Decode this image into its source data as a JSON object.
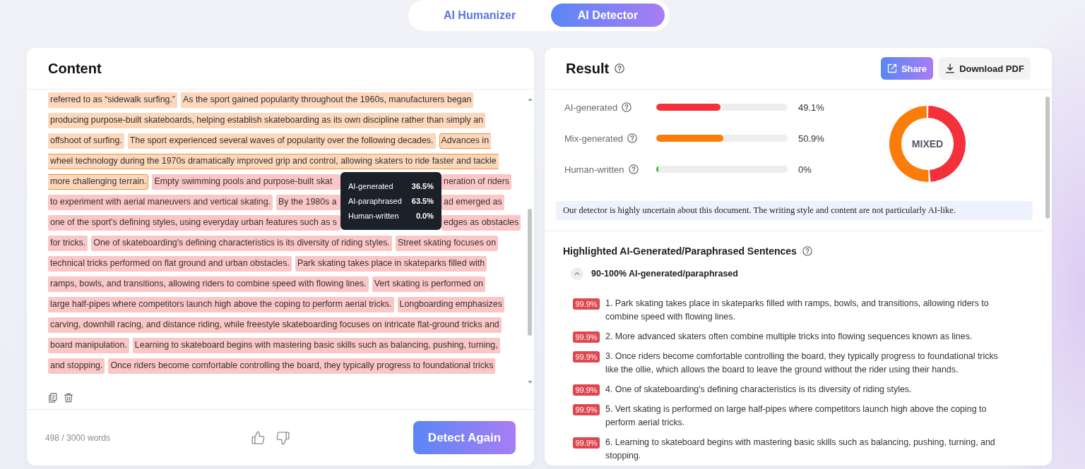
{
  "mode_tabs": [
    {
      "label": "AI Humanizer",
      "selected": false
    },
    {
      "label": "AI Detector",
      "selected": true
    }
  ],
  "content": {
    "title": "Content",
    "lines": [
      {
        "segments": [
          {
            "text": "referred to as “sidewalk surfing.”",
            "kind": "paraphrased",
            "selected": false
          },
          {
            "text": "As the sport gained popularity throughout the 1960s, manufacturers began",
            "kind": "paraphrased",
            "selected": false
          }
        ]
      },
      {
        "segments": [
          {
            "text": "producing purpose-built skateboards, helping establish skateboarding as its own discipline rather than simply an",
            "kind": "paraphrased",
            "selected": false
          }
        ]
      },
      {
        "segments": [
          {
            "text": "offshoot of surfing.",
            "kind": "paraphrased",
            "selected": false
          },
          {
            "text": "The sport experienced several waves of popularity over the following decades.",
            "kind": "paraphrased",
            "selected": false
          },
          {
            "text": "Advances in",
            "kind": "paraphrased",
            "selected": true
          }
        ]
      },
      {
        "segments": [
          {
            "text": "wheel technology during the 1970s dramatically improved grip and control, allowing skaters to ride faster and tackle",
            "kind": "paraphrased",
            "selected": true
          }
        ]
      },
      {
        "segments": [
          {
            "text": "more challenging terrain.",
            "kind": "paraphrased",
            "selected": true
          },
          {
            "text": "Empty swimming pools and purpose-built skat",
            "kind": "generated",
            "selected": false
          }
        ],
        "after_tooltip": [
          {
            "text": "neration of riders",
            "kind": "generated",
            "selected": false
          }
        ]
      },
      {
        "segments": [
          {
            "text": "to experiment with aerial maneuvers and vertical skating.",
            "kind": "generated",
            "selected": false
          },
          {
            "text": "By the 1980s a",
            "kind": "generated",
            "selected": false
          }
        ],
        "after_tooltip": [
          {
            "text": "ad emerged as",
            "kind": "generated",
            "selected": false
          }
        ]
      },
      {
        "segments": [
          {
            "text": "one of the sport's defining styles, using everyday urban features such as s",
            "kind": "generated",
            "selected": false
          }
        ],
        "after_tooltip": [
          {
            "text": "edges as obstacles",
            "kind": "generated",
            "selected": false
          }
        ]
      },
      {
        "segments": [
          {
            "text": "for tricks.",
            "kind": "generated",
            "selected": false
          },
          {
            "text": "One of skateboarding's defining characteristics is its diversity of riding styles.",
            "kind": "generated",
            "selected": false
          },
          {
            "text": "Street skating focuses on",
            "kind": "generated",
            "selected": false
          }
        ]
      },
      {
        "segments": [
          {
            "text": "technical tricks performed on flat ground and urban obstacles.",
            "kind": "generated",
            "selected": false
          },
          {
            "text": "Park skating takes place in skateparks filled with",
            "kind": "generated",
            "selected": false
          }
        ]
      },
      {
        "segments": [
          {
            "text": "ramps, bowls, and transitions, allowing riders to combine speed with flowing lines.",
            "kind": "generated",
            "selected": false
          },
          {
            "text": "Vert skating is performed on",
            "kind": "generated",
            "selected": false
          }
        ]
      },
      {
        "segments": [
          {
            "text": "large half-pipes where competitors launch high above the coping to perform aerial tricks.",
            "kind": "generated",
            "selected": false
          },
          {
            "text": "Longboarding emphasizes",
            "kind": "generated",
            "selected": false
          }
        ]
      },
      {
        "segments": [
          {
            "text": "carving, downhill racing, and distance riding, while freestyle skateboarding focuses on intricate flat-ground tricks and",
            "kind": "generated",
            "selected": false
          }
        ]
      },
      {
        "segments": [
          {
            "text": "board manipulation.",
            "kind": "generated",
            "selected": false
          },
          {
            "text": "Learning to skateboard begins with mastering basic skills such as balancing, pushing, turning,",
            "kind": "generated",
            "selected": false
          }
        ]
      },
      {
        "segments": [
          {
            "text": "and stopping.",
            "kind": "generated",
            "selected": false
          },
          {
            "text": "Once riders become comfortable controlling the board, they typically progress to foundational tricks",
            "kind": "generated",
            "selected": false
          }
        ]
      }
    ],
    "tooltip": {
      "rows": [
        {
          "label": "AI-generated",
          "value": "36.5%"
        },
        {
          "label": "AI-paraphrased",
          "value": "63.5%"
        },
        {
          "label": "Human-written",
          "value": "0.0%"
        }
      ]
    },
    "word_count": "498 / 3000 words",
    "detect_button": "Detect Again"
  },
  "result": {
    "title": "Result",
    "share_button": "Share",
    "download_button": "Download PDF",
    "stats": [
      {
        "label": "AI-generated",
        "level": 0.491,
        "value": "49.1%",
        "color": "#f4313a"
      },
      {
        "label": "Mix-generated",
        "level": 0.509,
        "value": "50.9%",
        "color": "#fa7c0a"
      },
      {
        "label": "Human-written",
        "level": 0,
        "value": "0%",
        "color": "#3cc13b"
      }
    ],
    "verdict": "MIXED",
    "notice": "Our detector is highly uncertain about this document. The writing style and content are not particularly AI-like.",
    "highlights": {
      "title": "Highlighted AI-Generated/Paraphrased Sentences",
      "groups": [
        {
          "title": "90-100% AI-generated/paraphrased",
          "expanded": true,
          "items": [
            {
              "score": "99.9%",
              "text": "1. Park skating takes place in skateparks filled with ramps, bowls, and transitions, allowing riders to combine speed with flowing lines."
            },
            {
              "score": "99.9%",
              "text": "2. More advanced skaters often combine multiple tricks into flowing sequences known as lines."
            },
            {
              "score": "99.9%",
              "text": "3. Once riders become comfortable controlling the board, they typically progress to foundational tricks like the ollie, which allows the board to leave the ground without the rider using their hands."
            },
            {
              "score": "99.9%",
              "text": "4. One of skateboarding's defining characteristics is its diversity of riding styles."
            },
            {
              "score": "99.9%",
              "text": "5. Vert skating is performed on large half-pipes where competitors launch high above the coping to perform aerial tricks."
            },
            {
              "score": "99.9%",
              "text": "6. Learning to skateboard begins with mastering basic skills such as balancing, pushing, turning, and stopping."
            }
          ]
        }
      ]
    }
  }
}
